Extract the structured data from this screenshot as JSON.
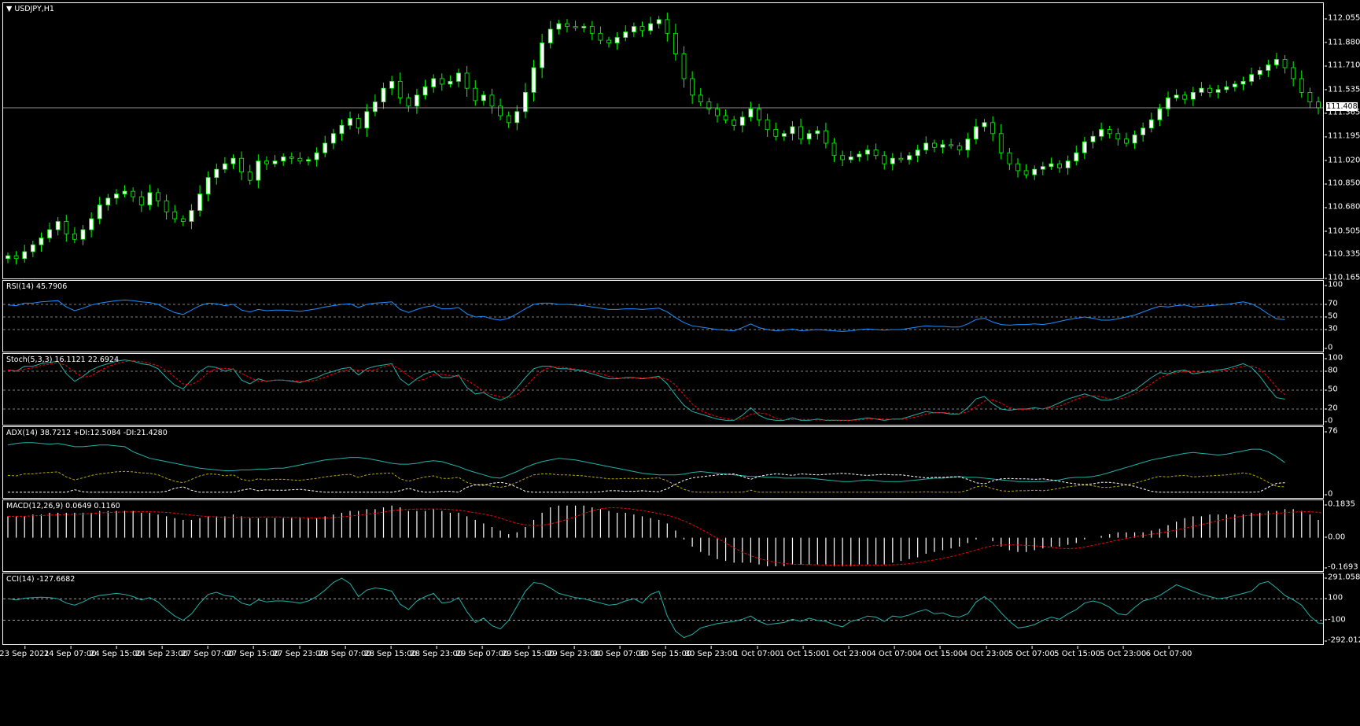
{
  "symbol_label": "USDJPY,H1",
  "current_price": "111.408",
  "panes": [
    {
      "id": "price",
      "label": "USDJPY,H1",
      "ticks": [
        "112.055",
        "111.880",
        "111.710",
        "111.535",
        "111.365",
        "111.195",
        "111.020",
        "110.850",
        "110.680",
        "110.505",
        "110.335",
        "110.165"
      ]
    },
    {
      "id": "rsi",
      "label": "RSI(14) 45.7906",
      "ticks": [
        "100",
        "70",
        "50",
        "30",
        "0"
      ]
    },
    {
      "id": "stoch",
      "label": "Stoch(5,3,3) 16.1121 22.6924",
      "ticks": [
        "100",
        "80",
        "50",
        "20",
        "0"
      ]
    },
    {
      "id": "adx",
      "label": "ADX(14) 38.7212 +DI:12.5084 -DI:21.4280",
      "ticks": [
        "76",
        "0"
      ]
    },
    {
      "id": "macd",
      "label": "MACD(12,26,9) 0.0649 0.1160",
      "ticks": [
        "0.1835",
        "0.00",
        "-0.1693"
      ]
    },
    {
      "id": "cci",
      "label": "CCI(14) -127.6682",
      "ticks": [
        "291.0583",
        "100",
        "-100",
        "-292.0126"
      ]
    }
  ],
  "time_labels": [
    "23 Sep 2021",
    "24 Sep 07:00",
    "24 Sep 15:00",
    "24 Sep 23:00",
    "27 Sep 07:00",
    "27 Sep 15:00",
    "27 Sep 23:00",
    "28 Sep 07:00",
    "28 Sep 15:00",
    "28 Sep 23:00",
    "29 Sep 07:00",
    "29 Sep 15:00",
    "29 Sep 23:00",
    "30 Sep 07:00",
    "30 Sep 15:00",
    "30 Sep 23:00",
    "1 Oct 07:00",
    "1 Oct 15:00",
    "1 Oct 23:00",
    "4 Oct 07:00",
    "4 Oct 15:00",
    "4 Oct 23:00",
    "5 Oct 07:00",
    "5 Oct 15:00",
    "5 Oct 23:00",
    "6 Oct 07:00"
  ],
  "colors": {
    "background": "#000000",
    "up_candle": "#ffffff",
    "down_candle": "#000000",
    "wick": "#00ff00",
    "rsi": "#1e90ff",
    "stoch_main": "#20b2aa",
    "stoch_signal": "#ff0000",
    "adx": "#20b2aa",
    "plus_di": "#b8a800",
    "minus_di": "#ffffff",
    "macd_hist": "#ffffff",
    "macd_signal": "#ff0000",
    "cci": "#20b2aa",
    "grid": "#ffffff"
  },
  "chart_data": {
    "type": "candlestick",
    "title": "USDJPY,H1",
    "ylim": [
      110.165,
      112.055
    ],
    "close": [
      110.33,
      110.31,
      110.36,
      110.41,
      110.46,
      110.52,
      110.58,
      110.49,
      110.45,
      110.52,
      110.6,
      110.7,
      110.75,
      110.78,
      110.8,
      110.76,
      110.7,
      110.79,
      110.73,
      110.65,
      110.6,
      110.58,
      110.66,
      110.78,
      110.9,
      110.96,
      111.0,
      111.04,
      110.94,
      110.88,
      111.02,
      111.0,
      111.02,
      111.05,
      111.04,
      111.02,
      111.03,
      111.08,
      111.15,
      111.22,
      111.28,
      111.33,
      111.26,
      111.38,
      111.45,
      111.55,
      111.6,
      111.48,
      111.42,
      111.5,
      111.56,
      111.62,
      111.58,
      111.6,
      111.66,
      111.55,
      111.46,
      111.5,
      111.42,
      111.35,
      111.3,
      111.38,
      111.52,
      111.7,
      111.88,
      111.98,
      112.02,
      112.0,
      111.99,
      112.0,
      111.95,
      111.9,
      111.88,
      111.92,
      111.96,
      112.0,
      111.97,
      112.02,
      112.05,
      111.95,
      111.8,
      111.62,
      111.5,
      111.45,
      111.4,
      111.35,
      111.32,
      111.28,
      111.34,
      111.4,
      111.32,
      111.25,
      111.2,
      111.22,
      111.27,
      111.18,
      111.22,
      111.24,
      111.15,
      111.06,
      111.03,
      111.05,
      111.07,
      111.1,
      111.06,
      111.0,
      111.04,
      111.03,
      111.06,
      111.1,
      111.15,
      111.12,
      111.14,
      111.13,
      111.1,
      111.18,
      111.27,
      111.3,
      111.22,
      111.08,
      111.0,
      110.95,
      110.92,
      110.96,
      110.98,
      111.0,
      110.97,
      111.02,
      111.08,
      111.16,
      111.2,
      111.25,
      111.22,
      111.18,
      111.15,
      111.21,
      111.26,
      111.32,
      111.4,
      111.48,
      111.5,
      111.47,
      111.52,
      111.55,
      111.52,
      111.54,
      111.56,
      111.58,
      111.6,
      111.65,
      111.68,
      111.72,
      111.76,
      111.7,
      111.62,
      111.52,
      111.45,
      111.408
    ],
    "rsi": [
      69,
      68,
      72,
      72,
      74,
      75,
      76,
      66,
      60,
      64,
      69,
      72,
      74,
      76,
      77,
      76,
      74,
      73,
      70,
      63,
      57,
      54,
      61,
      68,
      72,
      71,
      68,
      70,
      61,
      58,
      62,
      60,
      61,
      61,
      60,
      59,
      61,
      63,
      66,
      68,
      70,
      71,
      65,
      70,
      72,
      73,
      74,
      62,
      57,
      62,
      66,
      68,
      63,
      63,
      65,
      55,
      50,
      51,
      47,
      45,
      48,
      55,
      63,
      70,
      72,
      72,
      70,
      70,
      69,
      68,
      66,
      64,
      62,
      62,
      63,
      63,
      62,
      63,
      64,
      58,
      49,
      41,
      36,
      34,
      32,
      30,
      29,
      28,
      33,
      39,
      33,
      30,
      28,
      29,
      31,
      28,
      29,
      30,
      29,
      28,
      27,
      28,
      30,
      31,
      30,
      29,
      30,
      30,
      32,
      34,
      36,
      35,
      35,
      34,
      34,
      39,
      46,
      48,
      42,
      38,
      37,
      38,
      38,
      39,
      38,
      40,
      43,
      46,
      48,
      50,
      48,
      45,
      45,
      47,
      50,
      53,
      58,
      63,
      67,
      66,
      68,
      69,
      66,
      67,
      68,
      69,
      70,
      72,
      74,
      71,
      64,
      55,
      47,
      45.79
    ],
    "adx": [
      60,
      62,
      63,
      63,
      62,
      61,
      62,
      60,
      58,
      58,
      59,
      60,
      60,
      59,
      58,
      52,
      48,
      44,
      42,
      40,
      38,
      36,
      34,
      32,
      31,
      30,
      29,
      29,
      30,
      30,
      31,
      31,
      32,
      32,
      34,
      36,
      38,
      40,
      42,
      43,
      44,
      45,
      45,
      44,
      42,
      40,
      38,
      37,
      37,
      38,
      40,
      41,
      40,
      37,
      34,
      30,
      27,
      24,
      21,
      20,
      24,
      28,
      33,
      37,
      40,
      42,
      44,
      43,
      42,
      40,
      38,
      36,
      34,
      32,
      30,
      28,
      26,
      25,
      24,
      24,
      24,
      25,
      27,
      28,
      27,
      26,
      25,
      24,
      23,
      22,
      22,
      21,
      21,
      20,
      20,
      20,
      20,
      19,
      18,
      17,
      16,
      16,
      17,
      18,
      17,
      16,
      16,
      16,
      17,
      18,
      19,
      20,
      20,
      21,
      22,
      21,
      21,
      20,
      19,
      18,
      17,
      16,
      16,
      16,
      16,
      17,
      18,
      20,
      21,
      21,
      22,
      24,
      27,
      30,
      33,
      36,
      39,
      42,
      44,
      46,
      48,
      50,
      51,
      50,
      49,
      48,
      49,
      51,
      53,
      55,
      55,
      52,
      46,
      38.72
    ],
    "macd_hist": [
      0.12,
      0.12,
      0.12,
      0.13,
      0.13,
      0.14,
      0.14,
      0.14,
      0.14,
      0.14,
      0.14,
      0.15,
      0.15,
      0.15,
      0.15,
      0.15,
      0.14,
      0.14,
      0.13,
      0.12,
      0.11,
      0.1,
      0.1,
      0.11,
      0.12,
      0.12,
      0.12,
      0.13,
      0.12,
      0.11,
      0.11,
      0.11,
      0.11,
      0.11,
      0.11,
      0.11,
      0.11,
      0.11,
      0.12,
      0.13,
      0.14,
      0.15,
      0.15,
      0.16,
      0.16,
      0.17,
      0.18,
      0.17,
      0.15,
      0.15,
      0.15,
      0.16,
      0.15,
      0.14,
      0.14,
      0.12,
      0.1,
      0.08,
      0.06,
      0.04,
      0.02,
      0.03,
      0.06,
      0.1,
      0.14,
      0.17,
      0.18,
      0.18,
      0.18,
      0.18,
      0.17,
      0.16,
      0.15,
      0.14,
      0.14,
      0.13,
      0.12,
      0.11,
      0.1,
      0.08,
      0.04,
      -0.01,
      -0.05,
      -0.08,
      -0.1,
      -0.12,
      -0.13,
      -0.14,
      -0.14,
      -0.14,
      -0.15,
      -0.16,
      -0.16,
      -0.16,
      -0.15,
      -0.15,
      -0.15,
      -0.15,
      -0.15,
      -0.16,
      -0.16,
      -0.16,
      -0.15,
      -0.15,
      -0.15,
      -0.15,
      -0.14,
      -0.13,
      -0.12,
      -0.11,
      -0.09,
      -0.08,
      -0.07,
      -0.06,
      -0.05,
      -0.03,
      -0.01,
      0.0,
      -0.02,
      -0.05,
      -0.07,
      -0.08,
      -0.08,
      -0.07,
      -0.06,
      -0.05,
      -0.05,
      -0.04,
      -0.03,
      -0.01,
      0.0,
      0.01,
      0.02,
      0.03,
      0.03,
      0.03,
      0.03,
      0.04,
      0.05,
      0.07,
      0.09,
      0.11,
      0.12,
      0.12,
      0.13,
      0.13,
      0.13,
      0.13,
      0.13,
      0.14,
      0.14,
      0.15,
      0.15,
      0.16,
      0.16,
      0.15,
      0.13,
      0.1,
      0.08,
      0.065
    ],
    "cci": [
      100,
      90,
      105,
      110,
      115,
      110,
      100,
      60,
      40,
      70,
      110,
      130,
      140,
      150,
      140,
      120,
      90,
      110,
      70,
      0,
      -60,
      -100,
      -40,
      60,
      140,
      160,
      130,
      120,
      60,
      40,
      90,
      70,
      80,
      80,
      70,
      60,
      80,
      120,
      180,
      250,
      290,
      240,
      120,
      180,
      200,
      190,
      170,
      50,
      0,
      80,
      120,
      150,
      60,
      70,
      110,
      -20,
      -120,
      -80,
      -150,
      -180,
      -100,
      30,
      170,
      250,
      240,
      200,
      150,
      130,
      110,
      100,
      80,
      60,
      40,
      50,
      80,
      100,
      60,
      140,
      170,
      -60,
      -200,
      -260,
      -230,
      -170,
      -150,
      -130,
      -120,
      -110,
      -90,
      -60,
      -110,
      -140,
      -130,
      -120,
      -90,
      -110,
      -80,
      -100,
      -110,
      -140,
      -160,
      -110,
      -90,
      -60,
      -70,
      -110,
      -60,
      -70,
      -50,
      -20,
      0,
      -40,
      -30,
      -60,
      -70,
      -40,
      70,
      120,
      60,
      -30,
      -110,
      -170,
      -160,
      -140,
      -100,
      -70,
      -90,
      -40,
      0,
      60,
      80,
      60,
      20,
      -40,
      -50,
      20,
      80,
      100,
      130,
      180,
      230,
      200,
      170,
      140,
      120,
      100,
      110,
      130,
      150,
      170,
      240,
      260,
      200,
      130,
      90,
      40,
      -60,
      -125,
      -127.67
    ],
    "cci_range": [
      -292.0126,
      291.0583
    ],
    "macd_range": [
      -0.1693,
      0.1835
    ],
    "adx_range": [
      0,
      76
    ]
  }
}
